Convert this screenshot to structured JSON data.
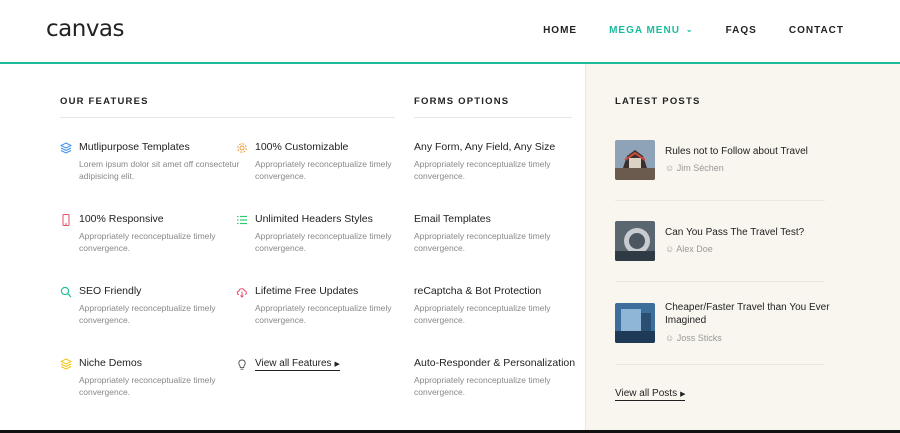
{
  "header": {
    "logo": "canvas",
    "nav": [
      {
        "label": "HOME"
      },
      {
        "label": "MEGA MENU"
      },
      {
        "label": "FAQS"
      },
      {
        "label": "CONTACT"
      }
    ],
    "accent_color": "#1abc9c"
  },
  "features": {
    "title": "OUR FEATURES",
    "items": [
      {
        "icon": "layers-icon",
        "title": "Mutlipurpose Templates",
        "desc": "Lorem ipsum dolor sit amet off consectetur adipisicing elit."
      },
      {
        "icon": "gear-icon",
        "title": "100% Customizable",
        "desc": "Appropriately reconceptualize timely convergence."
      },
      {
        "icon": "mobile-icon",
        "title": "100% Responsive",
        "desc": "Appropriately reconceptualize timely convergence."
      },
      {
        "icon": "list-icon",
        "title": "Unlimited Headers Styles",
        "desc": "Appropriately reconceptualize timely convergence."
      },
      {
        "icon": "search-icon",
        "title": "SEO Friendly",
        "desc": "Appropriately reconceptualize timely convergence."
      },
      {
        "icon": "cloud-download-icon",
        "title": "Lifetime Free Updates",
        "desc": "Appropriately reconceptualize timely convergence."
      },
      {
        "icon": "layers-icon",
        "title": "Niche Demos",
        "desc": "Appropriately reconceptualize timely convergence."
      }
    ],
    "view_all": "View all Features"
  },
  "forms": {
    "title": "FORMS OPTIONS",
    "items": [
      {
        "title": "Any Form, Any Field, Any Size",
        "desc": "Appropriately reconceptualize timely convergence."
      },
      {
        "title": "Email Templates",
        "desc": "Appropriately reconceptualize timely convergence."
      },
      {
        "title": "reCaptcha & Bot Protection",
        "desc": "Appropriately reconceptualize timely convergence."
      },
      {
        "title": "Auto-Responder & Personalization",
        "desc": "Appropriately reconceptualize timely convergence."
      }
    ]
  },
  "posts": {
    "title": "LATEST POSTS",
    "items": [
      {
        "title": "Rules not to Follow about Travel",
        "author": "Jim Séchen"
      },
      {
        "title": "Can You Pass The Travel Test?",
        "author": "Alex Doe"
      },
      {
        "title": "Cheaper/Faster Travel than You Ever Imagined",
        "author": "Joss Sticks"
      }
    ],
    "view_all": "View all Posts"
  }
}
